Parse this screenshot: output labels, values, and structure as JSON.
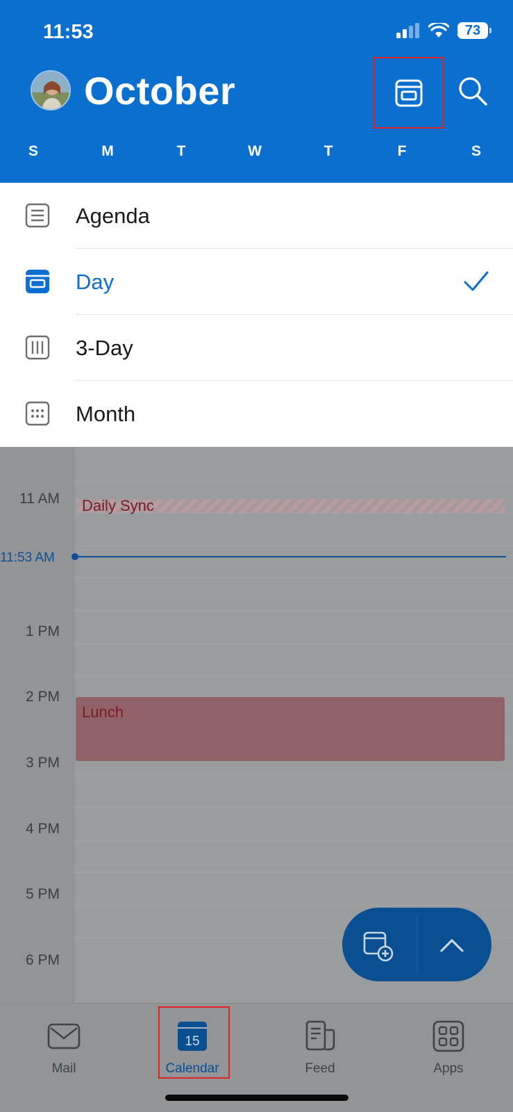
{
  "status_bar": {
    "time": "11:53",
    "battery": "73"
  },
  "header": {
    "month": "October",
    "view_icon": "day-view-icon",
    "search_icon": "search-icon"
  },
  "weekdays": [
    "S",
    "M",
    "T",
    "W",
    "T",
    "F",
    "S"
  ],
  "view_menu": {
    "items": [
      {
        "label": "Agenda",
        "icon": "agenda-icon",
        "selected": false
      },
      {
        "label": "Day",
        "icon": "day-view-icon",
        "selected": true
      },
      {
        "label": "3-Day",
        "icon": "three-day-icon",
        "selected": false
      },
      {
        "label": "Month",
        "icon": "month-icon",
        "selected": false
      }
    ]
  },
  "timeline": {
    "hours": [
      "11 AM",
      "1 PM",
      "2 PM",
      "3 PM",
      "4 PM",
      "5 PM",
      "6 PM"
    ],
    "now": "11:53 AM"
  },
  "events": [
    {
      "title": "Daily Sync"
    },
    {
      "title": "Lunch"
    }
  ],
  "tabbar": {
    "tabs": [
      {
        "label": "Mail",
        "icon": "mail-icon"
      },
      {
        "label": "Calendar",
        "icon": "calendar-icon",
        "badge": "15"
      },
      {
        "label": "Feed",
        "icon": "feed-icon"
      },
      {
        "label": "Apps",
        "icon": "apps-icon"
      }
    ],
    "active": "Calendar"
  },
  "colors": {
    "brand": "#0a6fcf",
    "event_red": "#936266",
    "highlight": "#e32020"
  }
}
